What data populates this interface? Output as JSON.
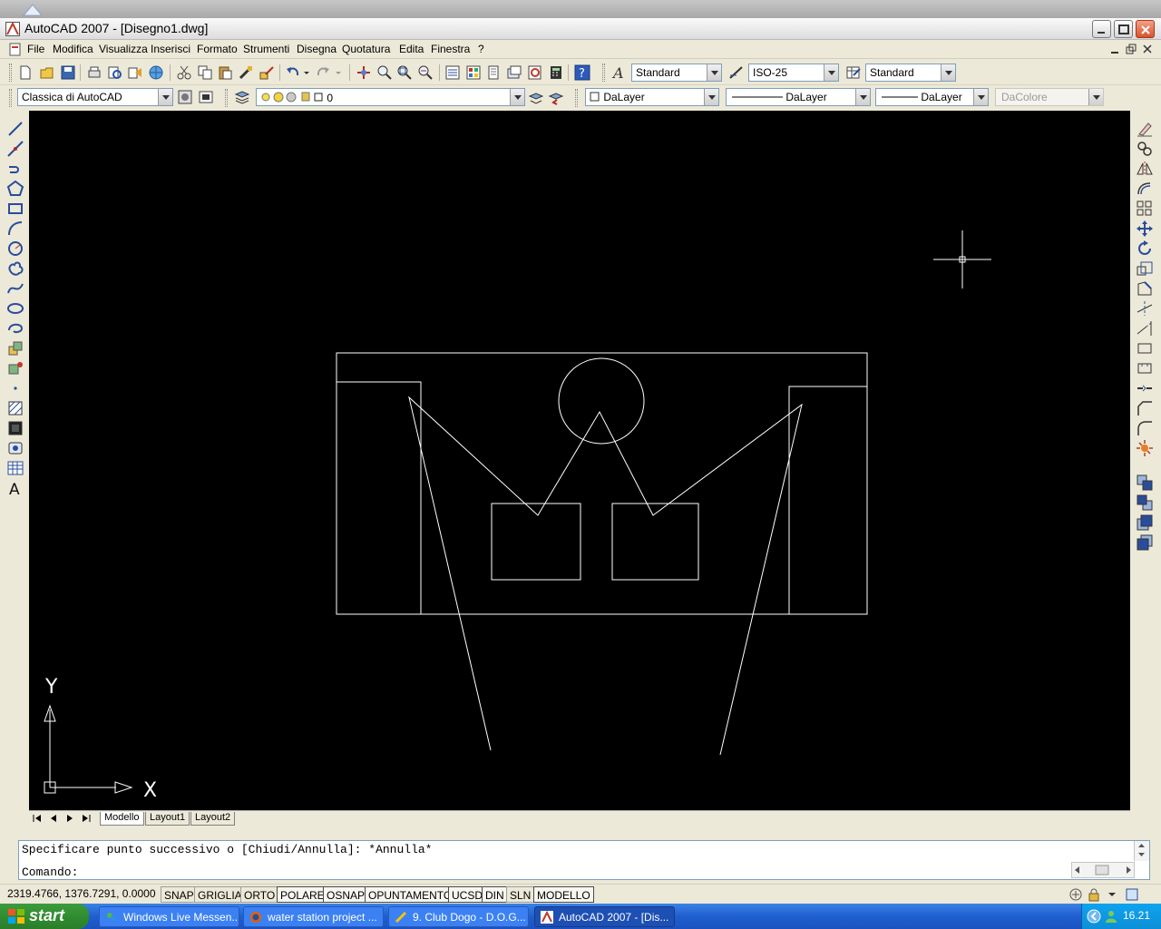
{
  "window": {
    "title": "AutoCAD 2007 - [Disegno1.dwg]"
  },
  "menu": [
    "File",
    "Modifica",
    "Visualizza",
    "Inserisci",
    "Formato",
    "Strumenti",
    "Disegna",
    "Quotatura",
    "Edita",
    "Finestra",
    "?"
  ],
  "toolbar_styles": {
    "text_style": "Standard",
    "dim_style": "ISO-25",
    "table_style": "Standard"
  },
  "toolbar_layers": {
    "workspace": "Classica di AutoCAD",
    "layer": "0",
    "color": "DaLayer",
    "linetype": "DaLayer",
    "lineweight": "DaLayer",
    "plot_style": "DaColore"
  },
  "drawing": {
    "ucs_x": "X",
    "ucs_y": "Y"
  },
  "layout_tabs": [
    "Modello",
    "Layout1",
    "Layout2"
  ],
  "command": {
    "history": "Specificare punto successivo o [Chiudi/Annulla]: *Annulla*",
    "prompt": "Comando:"
  },
  "status": {
    "coords": "2319.4766, 1376.7291, 0.0000",
    "toggles": [
      "SNAP",
      "GRIGLIA",
      "ORTO",
      "POLARE",
      "OSNAP",
      "OPUNTAMENTO",
      "UCSD",
      "DIN",
      "SLN",
      "MODELLO"
    ]
  },
  "taskbar": {
    "start": "start",
    "tasks": [
      "Windows Live Messen...",
      "water station project ...",
      "9. Club Dogo - D.O.G...",
      "AutoCAD 2007 - [Dis..."
    ],
    "clock": "16.21"
  },
  "colors": {
    "canvas": "#000000",
    "lines": "#ffffff",
    "taskbar": "#1f5fcf",
    "start": "#2f8a2f"
  }
}
